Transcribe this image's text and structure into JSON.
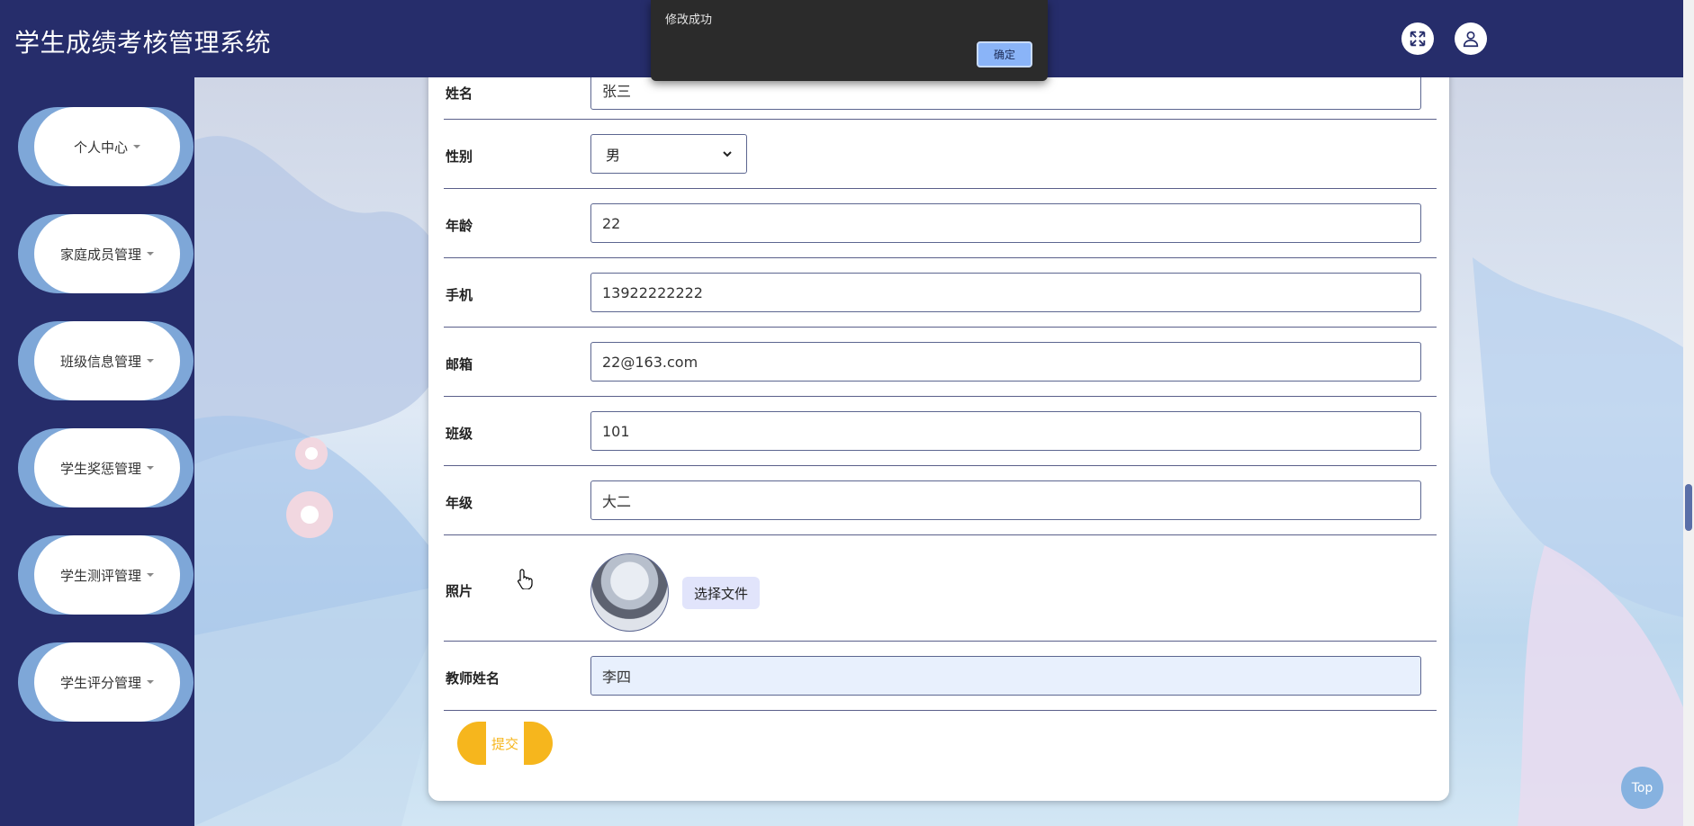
{
  "header": {
    "title": "学生成绩考核管理系统"
  },
  "sidebar": {
    "items": [
      {
        "label": "个人中心"
      },
      {
        "label": "家庭成员管理"
      },
      {
        "label": "班级信息管理"
      },
      {
        "label": "学生奖惩管理"
      },
      {
        "label": "学生测评管理"
      },
      {
        "label": "学生评分管理"
      }
    ]
  },
  "alert": {
    "message": "修改成功",
    "ok_label": "确定"
  },
  "form": {
    "name": {
      "label": "姓名",
      "value": "张三"
    },
    "gender": {
      "label": "性别",
      "value": "男"
    },
    "age": {
      "label": "年龄",
      "value": "22"
    },
    "phone": {
      "label": "手机",
      "value": "13922222222"
    },
    "email": {
      "label": "邮箱",
      "value": "22@163.com"
    },
    "class": {
      "label": "班级",
      "value": "101"
    },
    "grade": {
      "label": "年级",
      "value": "大二"
    },
    "photo": {
      "label": "照片",
      "file_button": "选择文件"
    },
    "teacher": {
      "label": "教师姓名",
      "value": "李四"
    },
    "submit_label": "提交"
  },
  "top_button": "Top",
  "icons": {
    "fullscreen": "expand-icon",
    "user": "user-icon"
  },
  "colors": {
    "header": "#262d6b",
    "accent": "#f6b61d",
    "sidebar_pill": "#7ea7d8"
  }
}
